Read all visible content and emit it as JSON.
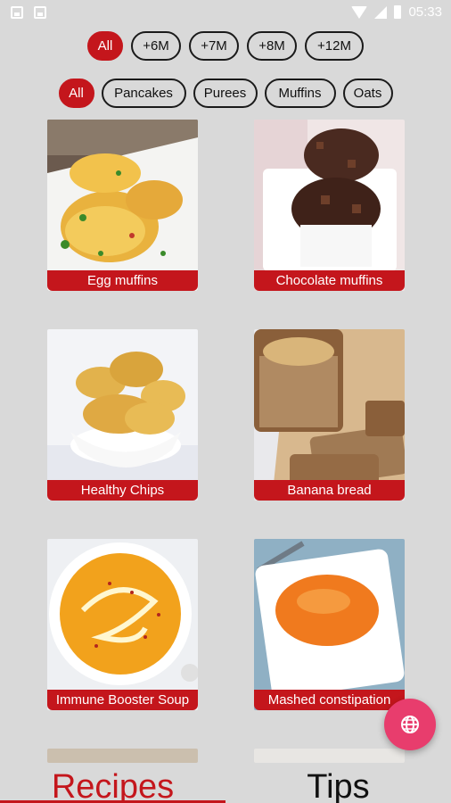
{
  "status_bar": {
    "time": "05:33"
  },
  "age_filters": [
    {
      "label": "All",
      "active": true
    },
    {
      "label": "+6M",
      "active": false
    },
    {
      "label": "+7M",
      "active": false
    },
    {
      "label": "+8M",
      "active": false
    },
    {
      "label": "+12M",
      "active": false
    }
  ],
  "category_filters": [
    {
      "label": "All",
      "active": true
    },
    {
      "label": "Pancakes",
      "active": false
    },
    {
      "label": "Purees",
      "active": false
    },
    {
      "label": "Muffins",
      "active": false
    },
    {
      "label": "Oats",
      "active": false
    }
  ],
  "recipes": [
    {
      "title": "Egg muffins"
    },
    {
      "title": "Chocolate muffins"
    },
    {
      "title": "Healthy Chips"
    },
    {
      "title": "Banana bread"
    },
    {
      "title": "Immune Booster Soup"
    },
    {
      "title": "Mashed constipation"
    }
  ],
  "bottom_tabs": {
    "recipes": "Recipes",
    "tips": "Tips"
  },
  "colors": {
    "accent": "#c4161c",
    "fab": "#e83d6d",
    "background": "#d9d9d9"
  },
  "fab_icon": "globe-icon"
}
